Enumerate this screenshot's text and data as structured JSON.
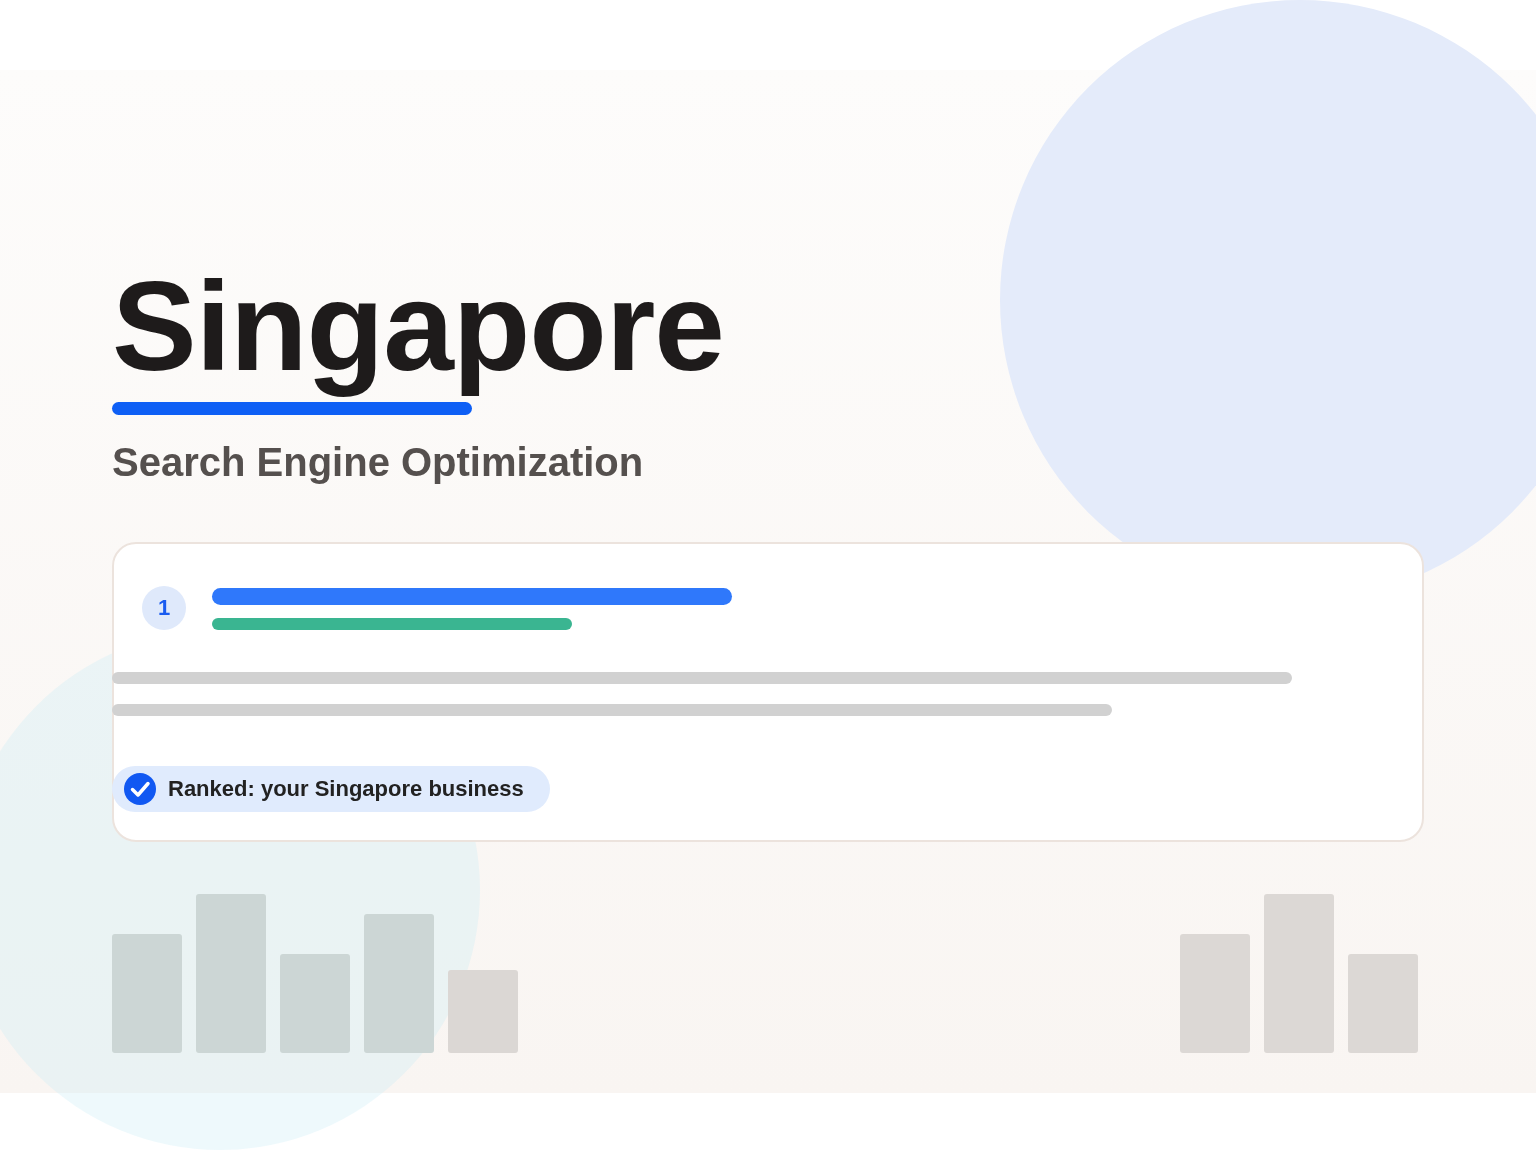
{
  "title": "Singapore",
  "subtitle": "Search Engine Optimization",
  "result": {
    "rank": "1",
    "badge": "Ranked: your Singapore business"
  }
}
